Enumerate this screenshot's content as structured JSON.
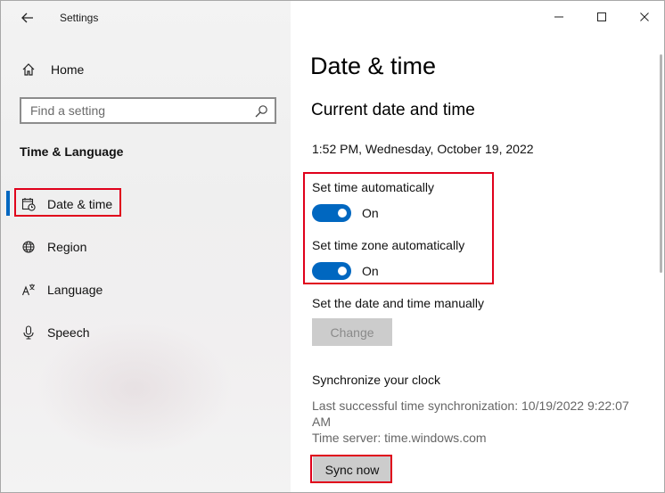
{
  "window": {
    "app_title": "Settings",
    "minimize_icon": "minimize-icon",
    "maximize_icon": "maximize-icon",
    "close_icon": "close-icon"
  },
  "sidebar": {
    "home_label": "Home",
    "search_placeholder": "Find a setting",
    "section_heading": "Time & Language",
    "items": [
      {
        "label": "Date & time",
        "icon": "calendar-clock-icon",
        "selected": true
      },
      {
        "label": "Region",
        "icon": "globe-icon",
        "selected": false
      },
      {
        "label": "Language",
        "icon": "language-icon",
        "selected": false
      },
      {
        "label": "Speech",
        "icon": "microphone-icon",
        "selected": false
      }
    ]
  },
  "main": {
    "page_title": "Date & time",
    "subtitle": "Current date and time",
    "current_datetime": "1:52 PM, Wednesday, October 19, 2022",
    "set_time_auto_label": "Set time automatically",
    "set_time_auto_state": "On",
    "set_tz_auto_label": "Set time zone automatically",
    "set_tz_auto_state": "On",
    "manual_label": "Set the date and time manually",
    "change_button": "Change",
    "sync_heading": "Synchronize your clock",
    "last_sync": "Last successful time synchronization: 10/19/2022 9:22:07 AM",
    "time_server": "Time server: time.windows.com",
    "sync_button": "Sync now"
  },
  "colors": {
    "accent": "#0067c0",
    "highlight": "#e0001b"
  }
}
